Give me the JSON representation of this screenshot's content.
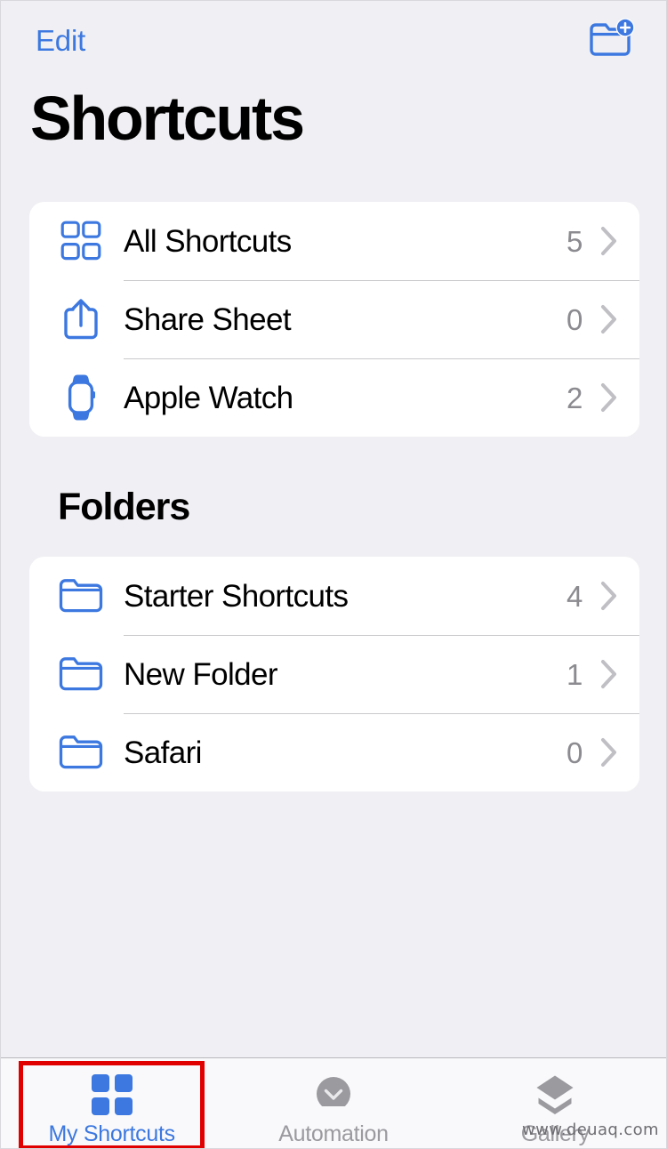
{
  "app": {
    "screen_title": "Shortcuts",
    "background_color": "#f0f0f4",
    "accent_color": "#3c78e0"
  },
  "navbar": {
    "edit_label": "Edit",
    "new_folder_icon": "folder-plus-icon"
  },
  "main_list": {
    "rows": [
      {
        "icon": "grid-2x2-icon",
        "label": "All Shortcuts",
        "count": "5",
        "chevron": "chevron-right-icon"
      },
      {
        "icon": "share-sheet-icon",
        "label": "Share Sheet",
        "count": "0",
        "chevron": "chevron-right-icon"
      },
      {
        "icon": "apple-watch-icon",
        "label": "Apple Watch",
        "count": "2",
        "chevron": "chevron-right-icon"
      }
    ]
  },
  "folders_section": {
    "header": "Folders",
    "rows": [
      {
        "icon": "folder-icon",
        "label": "Starter Shortcuts",
        "count": "4",
        "chevron": "chevron-right-icon"
      },
      {
        "icon": "folder-icon",
        "label": "New Folder",
        "count": "1",
        "chevron": "chevron-right-icon"
      },
      {
        "icon": "folder-icon",
        "label": "Safari",
        "count": "0",
        "chevron": "chevron-right-icon"
      }
    ]
  },
  "tabbar": {
    "active_index": 0,
    "tabs": [
      {
        "label": "My Shortcuts",
        "icon": "grid-2x2-filled-icon",
        "active": true
      },
      {
        "label": "Automation",
        "icon": "clock-circle-icon",
        "active": false
      },
      {
        "label": "Gallery",
        "icon": "stacked-layers-icon",
        "active": false
      }
    ]
  },
  "annotation": {
    "highlight_color": "#e00000",
    "highlight_target": "My Shortcuts"
  },
  "watermark": {
    "text": "www.deuaq.com"
  }
}
